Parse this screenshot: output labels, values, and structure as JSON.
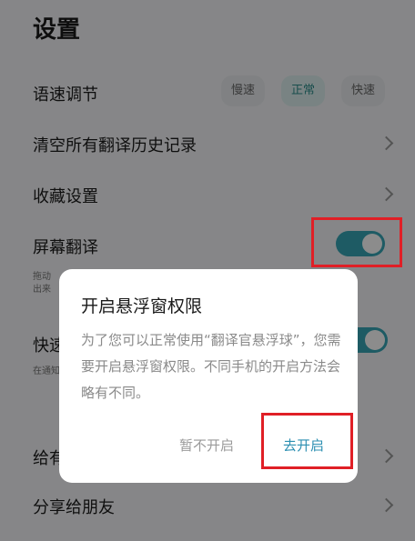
{
  "page": {
    "title": "设置"
  },
  "settings": {
    "speed": {
      "label": "语速调节",
      "options": [
        "慢速",
        "正常",
        "快速"
      ],
      "selected": "正常"
    },
    "clear_history": {
      "label": "清空所有翻译历史记录"
    },
    "favorites": {
      "label": "收藏设置"
    },
    "screen_translate": {
      "label": "屏幕翻译",
      "desc_line1": "拖动",
      "desc_line2": "出来",
      "enabled": true
    },
    "quick": {
      "label": "快速",
      "desc": "在通知",
      "enabled": true
    },
    "rate": {
      "label": "给有"
    },
    "share": {
      "label": "分享给朋友"
    }
  },
  "dialog": {
    "title": "开启悬浮窗权限",
    "message": "为了您可以正常使用“翻译官悬浮球”，您需要开启悬浮窗权限。不同手机的开启方法会略有不同。",
    "cancel_label": "暂不开启",
    "confirm_label": "去开启"
  },
  "colors": {
    "accent": "#38a7b6",
    "highlight": "#e01f26",
    "link": "#2c8fb2"
  }
}
